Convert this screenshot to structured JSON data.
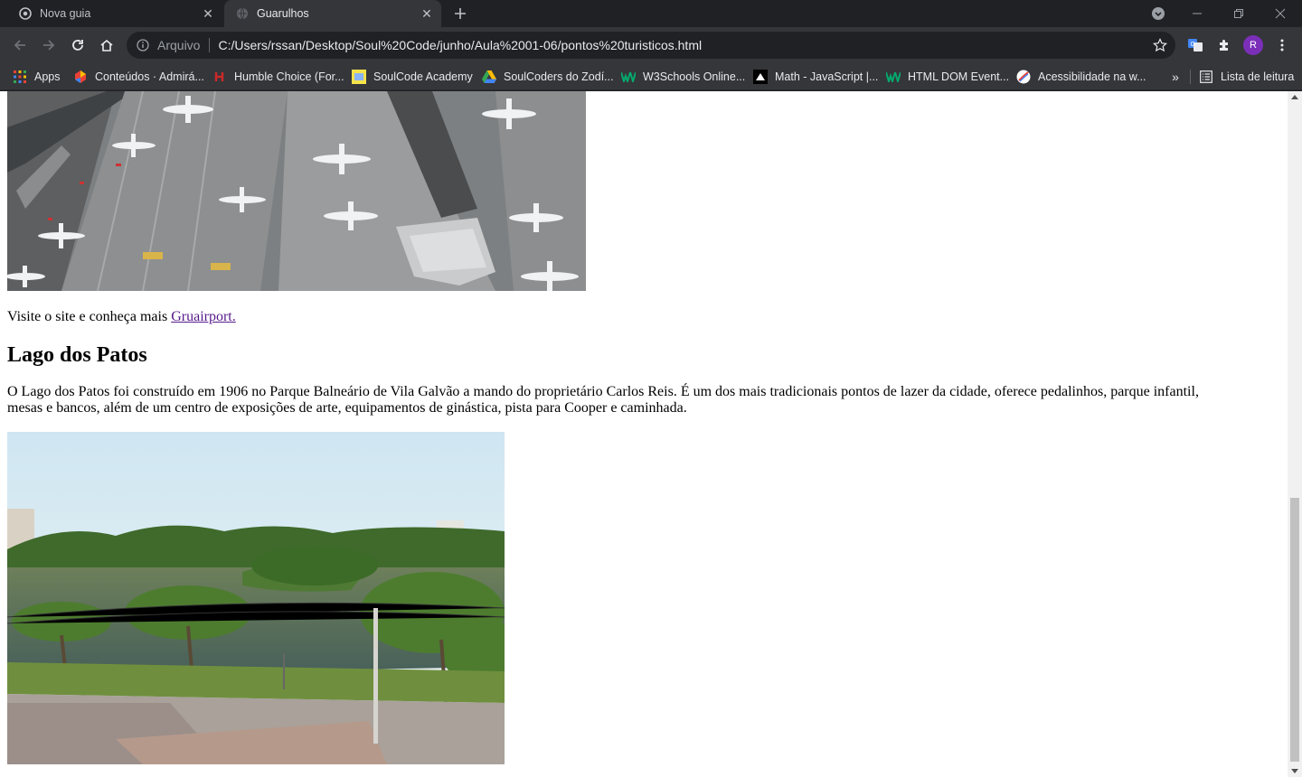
{
  "browser": {
    "tabs": [
      {
        "title": "Nova guia",
        "active": false
      },
      {
        "title": "Guarulhos",
        "active": true
      }
    ],
    "address": {
      "chip": "Arquivo",
      "url": "C:/Users/rssan/Desktop/Soul%20Code/junho/Aula%2001-06/pontos%20turisticos.html"
    },
    "profile_initial": "R",
    "bookmarks": [
      {
        "label": "Apps",
        "icon": "apps-grid-icon"
      },
      {
        "label": "Conteúdos · Admirá...",
        "icon": "colorful-logo-icon"
      },
      {
        "label": "Humble Choice (For...",
        "icon": "humble-icon"
      },
      {
        "label": "SoulCode Academy",
        "icon": "soulcode-icon"
      },
      {
        "label": "SoulCoders do Zodí...",
        "icon": "drive-icon"
      },
      {
        "label": "W3Schools Online...",
        "icon": "w3schools-icon"
      },
      {
        "label": "Math - JavaScript |...",
        "icon": "mdn-icon"
      },
      {
        "label": "HTML DOM Event...",
        "icon": "w3schools-icon"
      },
      {
        "label": "Acessibilidade na w...",
        "icon": "a11y-icon"
      }
    ],
    "reading_list": "Lista de leitura"
  },
  "page": {
    "visit_text": "Visite o site e conheça mais ",
    "visit_link": "Gruairport.",
    "heading": "Lago dos Patos",
    "paragraph": "O Lago dos Patos foi construído em 1906 no Parque Balneário de Vila Galvão a mando do proprietário Carlos Reis. É um dos mais tradicionais pontos de lazer da cidade, oferece pedalinhos, parque infantil, mesas e bancos, além de um centro de exposições de arte, equipamentos de ginástica, pista para Cooper e caminhada."
  },
  "colors": {
    "frame": "#202124",
    "toolbar": "#35363a",
    "link_visited": "#551a8b",
    "avatar": "#7b2fb8"
  }
}
